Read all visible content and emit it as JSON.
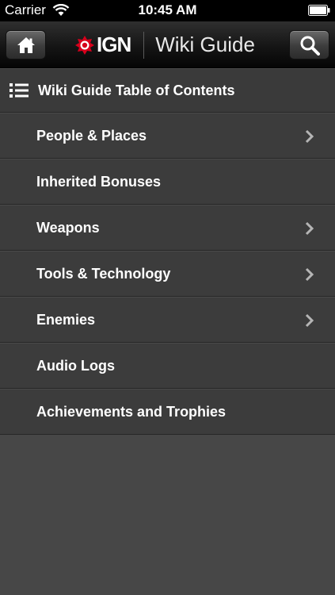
{
  "status_bar": {
    "carrier": "Carrier",
    "time": "10:45 AM"
  },
  "nav": {
    "logo_text": "IGN",
    "title": "Wiki Guide",
    "home_icon": "home-icon",
    "search_icon": "search-icon"
  },
  "toc": {
    "header": "Wiki Guide Table of Contents",
    "items": [
      {
        "label": "People & Places",
        "has_children": true
      },
      {
        "label": "Inherited Bonuses",
        "has_children": false
      },
      {
        "label": "Weapons",
        "has_children": true
      },
      {
        "label": "Tools & Technology",
        "has_children": true
      },
      {
        "label": "Enemies",
        "has_children": true
      },
      {
        "label": "Audio Logs",
        "has_children": false
      },
      {
        "label": "Achievements and Trophies",
        "has_children": false
      }
    ]
  },
  "colors": {
    "ign_red": "#d7001c",
    "background": "#474747",
    "row": "#3c3c3c"
  }
}
